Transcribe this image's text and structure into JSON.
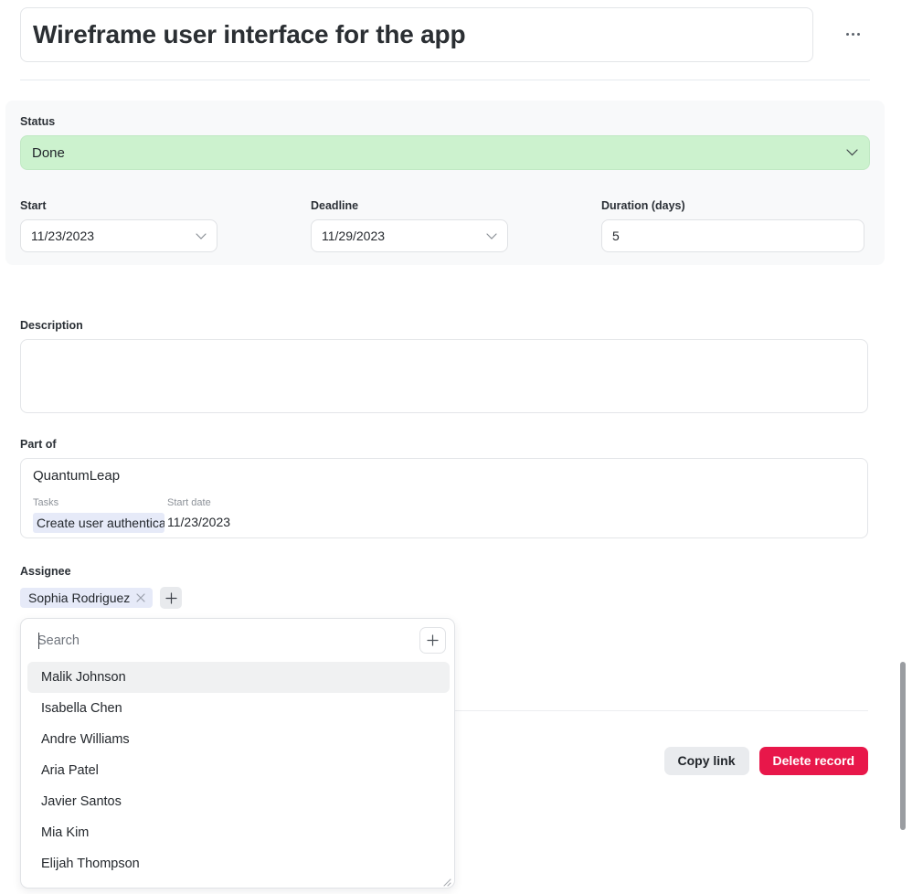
{
  "record": {
    "title": "Wireframe user interface for the app",
    "more_menu_label": "..."
  },
  "status": {
    "label": "Status",
    "value": "Done",
    "color": "#ccf2ce"
  },
  "dates": {
    "start": {
      "label": "Start",
      "value": "11/23/2023"
    },
    "deadline": {
      "label": "Deadline",
      "value": "11/29/2023"
    },
    "duration": {
      "label": "Duration (days)",
      "value": "5"
    }
  },
  "description": {
    "label": "Description",
    "value": "",
    "placeholder": ""
  },
  "part_of": {
    "label": "Part of",
    "card_title": "QuantumLeap",
    "columns": [
      {
        "header": "Tasks",
        "value": "Create user authentication"
      },
      {
        "header": "Start date",
        "value": "11/23/2023"
      }
    ]
  },
  "assignee": {
    "label": "Assignee",
    "chips": [
      {
        "name": "Sophia Rodriguez",
        "remove_label": "×"
      }
    ],
    "add_label": "+"
  },
  "dropdown": {
    "search_placeholder": "Search",
    "search_value": "",
    "add_label": "+",
    "options": [
      {
        "name": "Malik Johnson",
        "active": true
      },
      {
        "name": "Isabella Chen",
        "active": false
      },
      {
        "name": "Andre Williams",
        "active": false
      },
      {
        "name": "Aria Patel",
        "active": false
      },
      {
        "name": "Javier Santos",
        "active": false
      },
      {
        "name": "Mia Kim",
        "active": false
      },
      {
        "name": "Elijah Thompson",
        "active": false
      }
    ]
  },
  "footer": {
    "copy_link_label": "Copy link",
    "delete_label": "Delete record",
    "delete_color": "#e8174a"
  }
}
